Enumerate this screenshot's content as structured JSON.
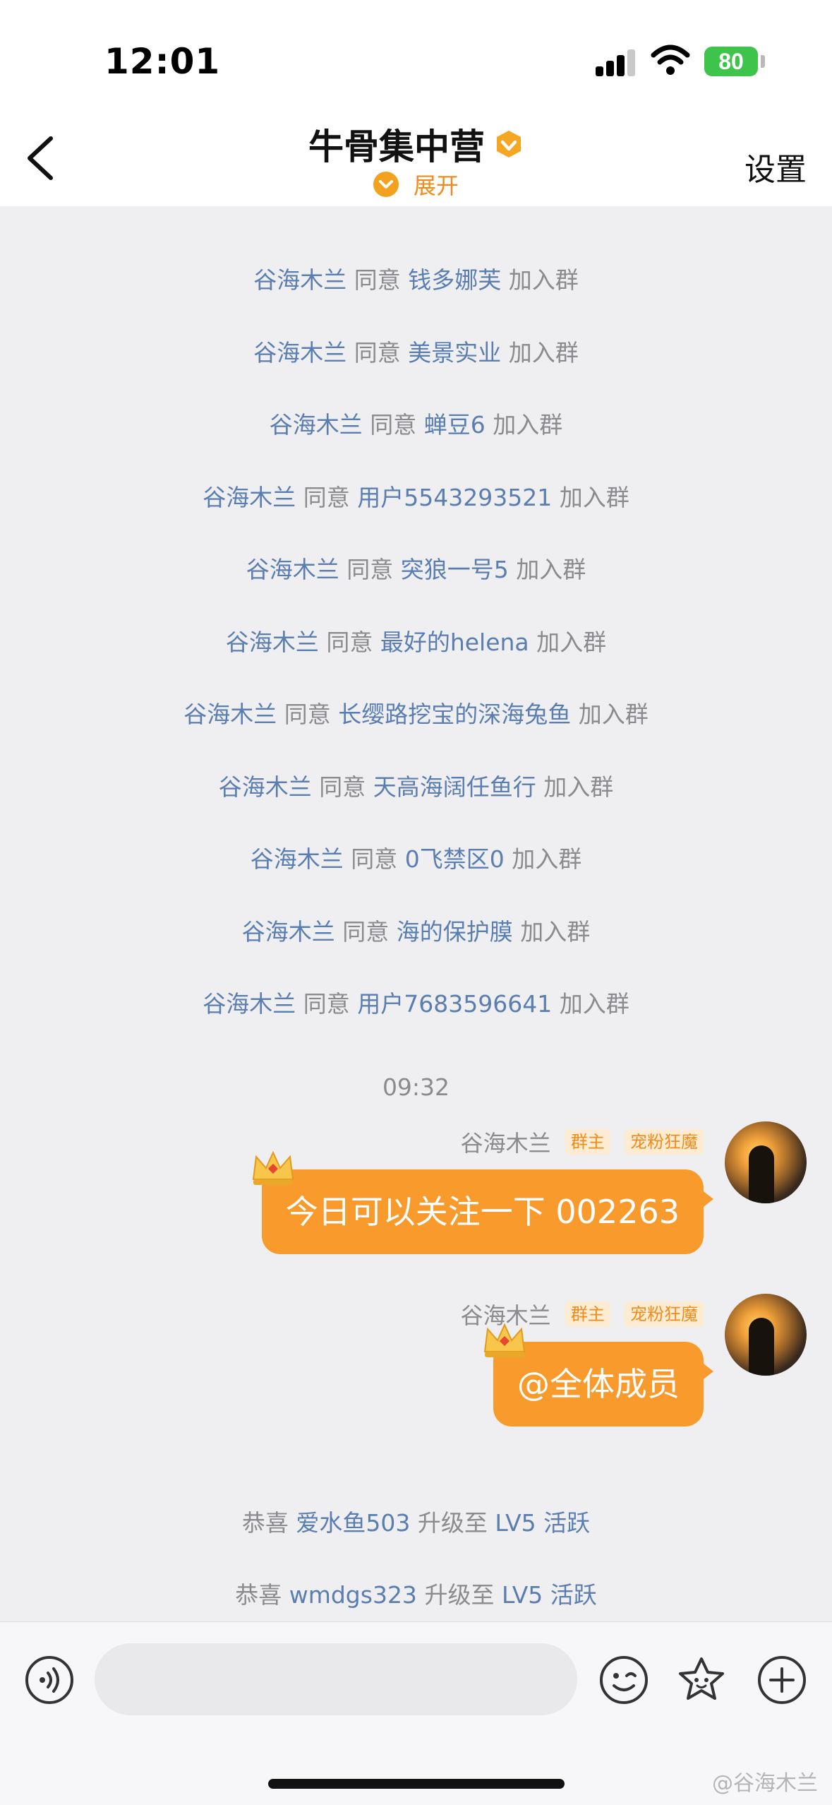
{
  "status_bar": {
    "time": "12:01",
    "battery": "80"
  },
  "header": {
    "title": "牛骨集中营",
    "expand_label": "展开",
    "settings_label": "设置"
  },
  "system_messages": [
    {
      "actor": "谷海木兰",
      "verb": "同意",
      "target": "钱多娜芙",
      "suffix": "加入群"
    },
    {
      "actor": "谷海木兰",
      "verb": "同意",
      "target": "美景实业",
      "suffix": "加入群"
    },
    {
      "actor": "谷海木兰",
      "verb": "同意",
      "target": "蝉豆6",
      "suffix": "加入群"
    },
    {
      "actor": "谷海木兰",
      "verb": "同意",
      "target": "用户5543293521",
      "suffix": "加入群"
    },
    {
      "actor": "谷海木兰",
      "verb": "同意",
      "target": "突狼一号5",
      "suffix": "加入群"
    },
    {
      "actor": "谷海木兰",
      "verb": "同意",
      "target": "最好的helena",
      "suffix": "加入群"
    },
    {
      "actor": "谷海木兰",
      "verb": "同意",
      "target": "长缨路挖宝的深海兔鱼",
      "suffix": "加入群"
    },
    {
      "actor": "谷海木兰",
      "verb": "同意",
      "target": "天高海阔任鱼行",
      "suffix": "加入群"
    },
    {
      "actor": "谷海木兰",
      "verb": "同意",
      "target": "0飞禁区0",
      "suffix": "加入群"
    },
    {
      "actor": "谷海木兰",
      "verb": "同意",
      "target": "海的保护膜",
      "suffix": "加入群"
    },
    {
      "actor": "谷海木兰",
      "verb": "同意",
      "target": "用户7683596641",
      "suffix": "加入群"
    }
  ],
  "time_label": "09:32",
  "messages": [
    {
      "sender": "谷海木兰",
      "tag_owner": "群主",
      "tag_fan": "宠粉狂魔",
      "text": "今日可以关注一下  002263"
    },
    {
      "sender": "谷海木兰",
      "tag_owner": "群主",
      "tag_fan": "宠粉狂魔",
      "text": "@全体成员"
    }
  ],
  "level_messages": [
    {
      "prefix": "恭喜",
      "user": "爱水鱼503",
      "middle": "升级至",
      "level": "LV5 活跃"
    },
    {
      "prefix": "恭喜",
      "user": "wmdgs323",
      "middle": "升级至",
      "level": "LV5 活跃"
    }
  ],
  "watermark": "@谷海木兰",
  "colors": {
    "accent": "#f89a2c",
    "link": "#5a7eb0",
    "muted": "#8a8a8f",
    "battery": "#3ec44a"
  }
}
